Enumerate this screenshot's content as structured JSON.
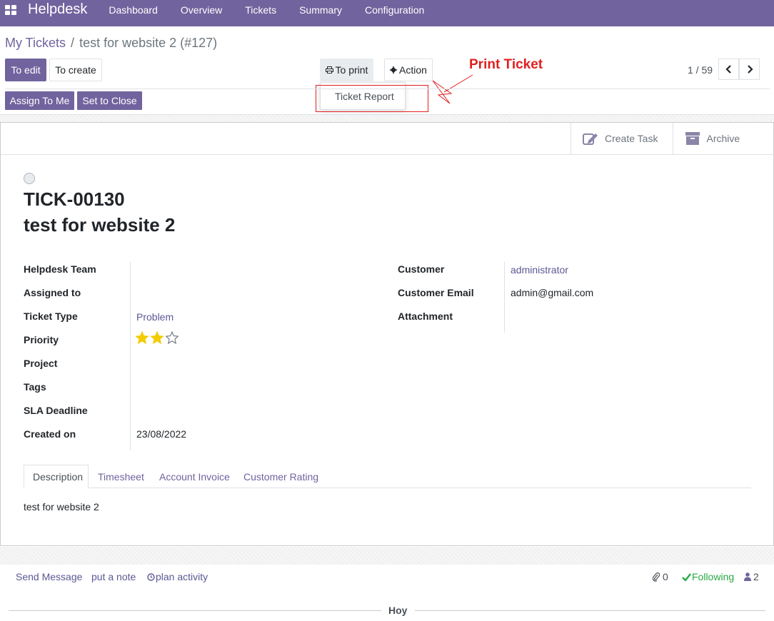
{
  "navbar": {
    "brand": "Helpdesk",
    "menu": [
      "Dashboard",
      "Overview",
      "Tickets",
      "Summary",
      "Configuration"
    ]
  },
  "breadcrumb": {
    "parent": "My Tickets",
    "separator": "/",
    "current": "test for website 2 (#127)"
  },
  "toolbar": {
    "edit_label": "To edit",
    "create_label": "To create",
    "print_label": "To print",
    "action_label": "Action"
  },
  "print_menu": {
    "items": [
      "Ticket Report"
    ]
  },
  "annotation": {
    "text": "Print Ticket",
    "color": "#e02020"
  },
  "pager": {
    "value": "1 / 59"
  },
  "header_buttons": {
    "assign": "Assign To Me",
    "close": "Set to Close"
  },
  "smart_buttons": {
    "create_task": "Create Task",
    "archive": "Archive"
  },
  "ticket": {
    "number": "TICK-00130",
    "name": "test for website 2"
  },
  "fields_left": {
    "team_label": "Helpdesk Team",
    "assigned_label": "Assigned to",
    "type_label": "Ticket Type",
    "type_value": "Problem",
    "priority_label": "Priority",
    "priority_value": 2,
    "priority_max": 3,
    "project_label": "Project",
    "tags_label": "Tags",
    "sla_label": "SLA Deadline",
    "created_label": "Created on",
    "created_value": "23/08/2022"
  },
  "fields_right": {
    "customer_label": "Customer",
    "customer_value": "administrator",
    "email_label": "Customer Email",
    "email_value": "admin@gmail.com",
    "attachment_label": "Attachment"
  },
  "notebook": {
    "tabs": [
      "Description",
      "Timesheet",
      "Account Invoice",
      "Customer Rating"
    ],
    "active": "Description",
    "description": "test for website 2"
  },
  "chatter": {
    "send_message": "Send Message",
    "log_note": "put a note",
    "plan_activity": "plan activity",
    "attachments_count": "0",
    "following": "Following",
    "followers_count": "2",
    "date_separator": "Hoy"
  },
  "colors": {
    "brand": "#71639e",
    "star": "#f3cc00",
    "following": "#28a745"
  },
  "icons": [
    "apps-icon",
    "printer-icon",
    "gear-icon",
    "chevron-left-icon",
    "chevron-right-icon",
    "edit-icon",
    "archive-icon",
    "paperclip-icon",
    "check-icon",
    "user-icon",
    "clock-icon",
    "star-icon"
  ]
}
